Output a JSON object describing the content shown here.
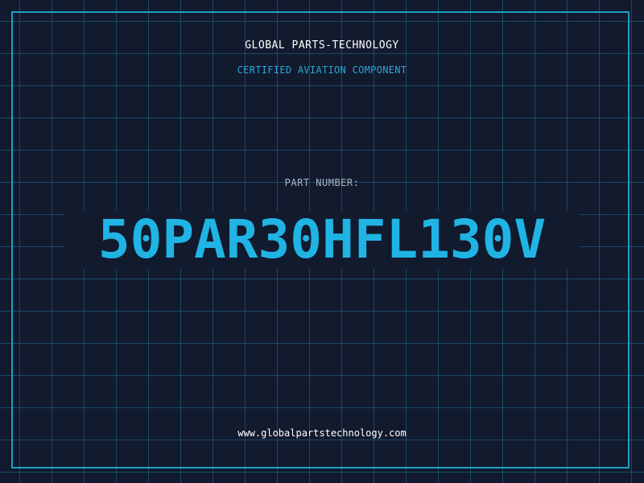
{
  "header": {
    "company": "GLOBAL PARTS-TECHNOLOGY",
    "subtitle": "CERTIFIED AVIATION COMPONENT"
  },
  "part": {
    "label": "PART NUMBER:",
    "number": "50PAR30HFL130V"
  },
  "footer": {
    "url": "www.globalpartstechnology.com"
  },
  "colors": {
    "background": "#121a2e",
    "grid": "#1f6f96",
    "accent": "#1fb4e4",
    "text": "#ffffff"
  }
}
